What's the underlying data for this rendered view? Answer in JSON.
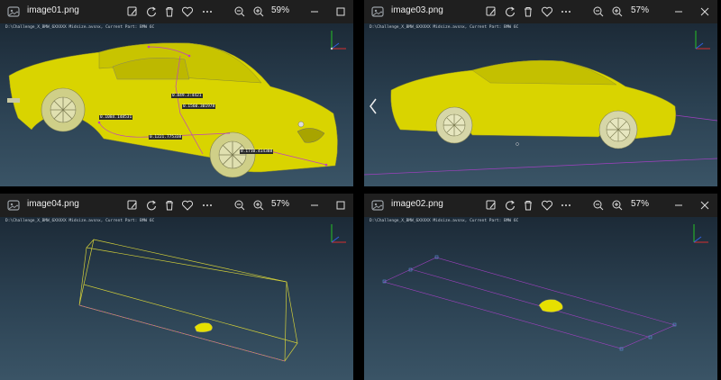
{
  "windows": [
    {
      "file_name": "image01.png",
      "zoom": "59%",
      "path_text": "D:\\Challenge_X_BMW_6XXXXX Midsize.avsnx, Current Part: BMW 6C",
      "measurements": [
        "0.849.3:4421",
        "0.1560.301978",
        "0.1084.148531",
        "0.1221.775338",
        "0.1710.414388"
      ]
    },
    {
      "file_name": "image03.png",
      "zoom": "57%",
      "path_text": "D:\\Challenge_X_BMW_6XXXXX Midsize.avsnx, Current Part: BMW 6C"
    },
    {
      "file_name": "image04.png",
      "zoom": "57%",
      "path_text": "D:\\Challenge_X_BMW_6XXXXX Midsize.avsnx, Current Part: BMW 6C"
    },
    {
      "file_name": "image02.png",
      "zoom": "57%",
      "path_text": "D:\\Challenge_X_BMW_6XXXXX Midsize.avsnx, Current Part: BMW 6C"
    }
  ],
  "icons": [
    "photos-app-icon",
    "edit-icon",
    "rotate-icon",
    "delete-icon",
    "favorite-icon",
    "more-icon",
    "zoom-out-icon",
    "zoom-in-icon",
    "minimize-icon",
    "maximize-icon",
    "close-icon"
  ],
  "colors": {
    "car_yellow": "#d9d400",
    "bbox_line": "#d2cf3a",
    "selection_line": "#c040c0",
    "titlebar": "#1f1f1f"
  }
}
